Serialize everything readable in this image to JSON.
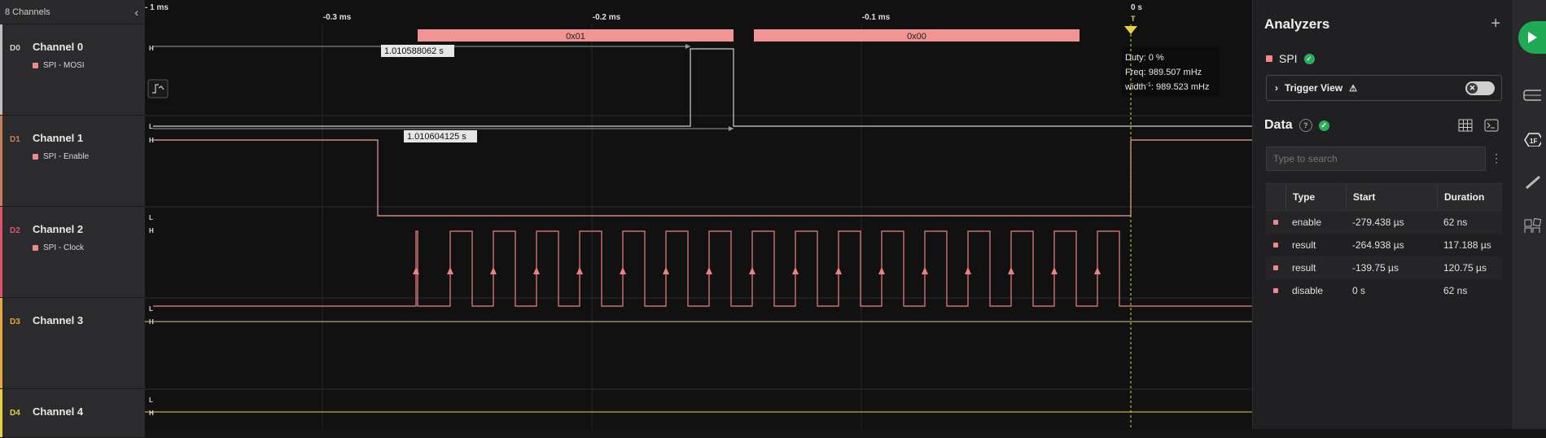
{
  "channels_header": {
    "title": "8 Channels"
  },
  "channels": [
    {
      "code": "D0",
      "name": "Channel 0",
      "sub": "SPI - MOSI",
      "color": "#bfbfbf"
    },
    {
      "code": "D1",
      "name": "Channel 1",
      "sub": "SPI - Enable",
      "color": "#c47f5a"
    },
    {
      "code": "D2",
      "name": "Channel 2",
      "sub": "SPI - Clock",
      "color": "#e0506a"
    },
    {
      "code": "D3",
      "name": "Channel 3",
      "sub": "",
      "color": "#e8a83a"
    },
    {
      "code": "D4",
      "name": "Channel 4",
      "sub": "",
      "color": "#e8d23a"
    }
  ],
  "timeline": {
    "scale": "- 1 ms",
    "ticks": [
      "-0.3 ms",
      "-0.2 ms",
      "-0.1 ms",
      "0 s"
    ],
    "trigger": "T"
  },
  "spi_frames": [
    "0x01",
    "0x00"
  ],
  "measurements": {
    "m1": "1.010588062 s",
    "m2": "1.010604125 s"
  },
  "tooltip": {
    "duty": "Duty: 0 %",
    "freq": "Freq: 989.507 mHz",
    "width_pre": "width",
    "width_sup": "-1",
    "width_val": ": 989.523 mHz"
  },
  "levels": {
    "high": "H",
    "low": "L"
  },
  "panel": {
    "title": "Analyzers",
    "add": "+",
    "analyzer_name": "SPI",
    "trigger_view": "Trigger View",
    "data_title": "Data",
    "search_placeholder": "Type to search",
    "columns": [
      "Type",
      "Start",
      "Duration"
    ],
    "rows": [
      {
        "type": "enable",
        "start": "-279.438 µs",
        "duration": "62 ns"
      },
      {
        "type": "result",
        "start": "-264.938 µs",
        "duration": "117.188 µs"
      },
      {
        "type": "result",
        "start": "-139.75 µs",
        "duration": "120.75 µs"
      },
      {
        "type": "disable",
        "start": "0 s",
        "duration": "62 ns"
      }
    ]
  },
  "colors": {
    "accent": "#1faa55",
    "frame": "#f29494",
    "trace_pink": "#f08080",
    "trace_white": "#cfcfcf"
  }
}
